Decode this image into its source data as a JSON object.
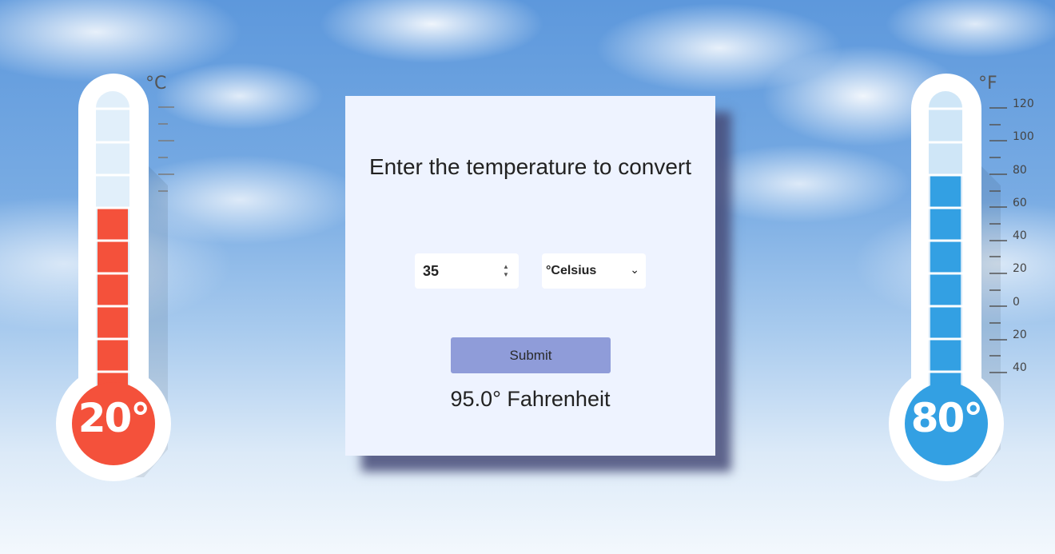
{
  "left_thermometer": {
    "unit_label": "°C",
    "bulb_label": "20°",
    "fill_fraction": 0.58,
    "fill_color": "#f4513b"
  },
  "right_thermometer": {
    "unit_label": "°F",
    "bulb_label": "80°",
    "fill_fraction": 0.72,
    "fill_color": "#33a0e3",
    "scale": [
      "120",
      "100",
      "80",
      "60",
      "40",
      "20",
      "0",
      "20",
      "40"
    ]
  },
  "converter": {
    "title": "Enter the temperature to convert",
    "input_value": "35",
    "unit_selected": "°Celsius",
    "submit_label": "Submit",
    "result": "95.0° Fahrenheit"
  },
  "icons": [
    "spinner-icon",
    "chevron-down-icon"
  ]
}
